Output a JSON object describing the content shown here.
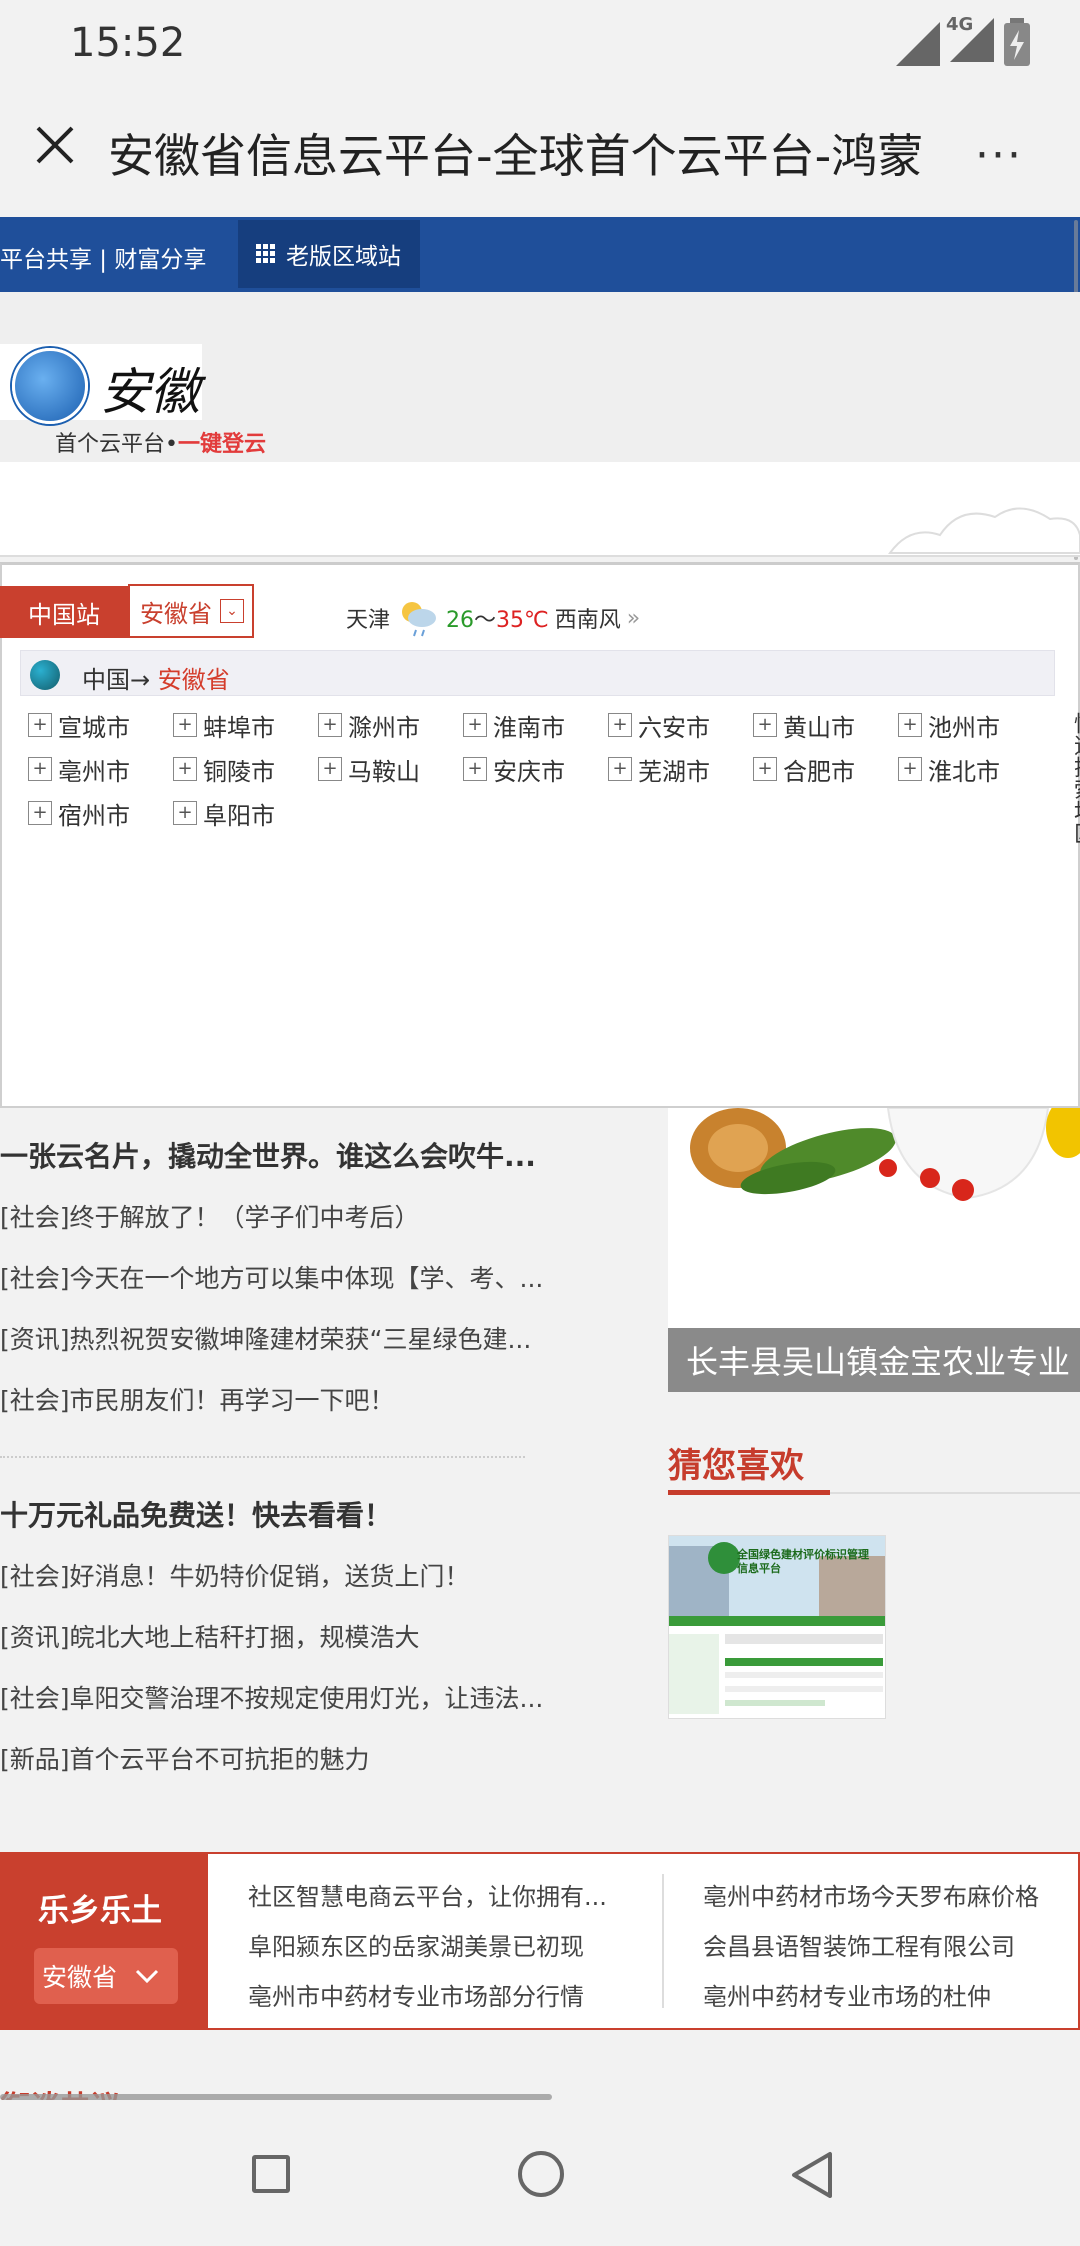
{
  "status": {
    "time": "15:52",
    "network": "4G"
  },
  "browser": {
    "title": "安徽省信息云平台-全球首个云平台-鸿蒙",
    "more": "···"
  },
  "topnav": {
    "links": "平台共享 | 财富分享",
    "old_site": "老版区域站"
  },
  "logo": {
    "tagline_prefix": "首个云平台•",
    "tagline_highlight": "一键登云"
  },
  "region": {
    "station_tab": "中国站",
    "province": "安徽省",
    "weather": {
      "city": "天津",
      "low": "26",
      "sep": "～",
      "high": "35℃",
      "wind": "西南风"
    },
    "crumb_prefix": "中国→",
    "crumb_current": "安徽省",
    "cities": [
      "宣城市",
      "蚌埠市",
      "滁州市",
      "淮南市",
      "六安市",
      "黄山市",
      "池州市",
      "亳州市",
      "铜陵市",
      "马鞍山",
      "安庆市",
      "芜湖市",
      "合肥市",
      "淮北市",
      "宿州市",
      "阜阳市"
    ],
    "side_text": "快速搜索地区"
  },
  "news": {
    "group1_title": "一张云名片，撬动全世界。谁这么会吹牛...",
    "group1_items": [
      "[社会]终于解放了！（学子们中考后）",
      "[社会]今天在一个地方可以集中体现【学、考、...",
      "[资讯]热烈祝贺安徽坤隆建材荣获“三星绿色建...",
      "[社会]市民朋友们！再学习一下吧！"
    ],
    "group2_title": "十万元礼品免费送！快去看看！",
    "group2_items": [
      "[社会]好消息！牛奶特价促销，送货上门！",
      "[资讯]皖北大地上秸秆打捆，规模浩大",
      "[社会]阜阳交警治理不按规定使用灯光，让违法...",
      "[新品]首个云平台不可抗拒的魅力"
    ]
  },
  "feature": {
    "caption": "长丰县吴山镇金宝农业专业"
  },
  "guess": {
    "title": "猜您喜欢",
    "thumb_heading": "全国绿色建材评价标识管理信息平台"
  },
  "strip": {
    "title": "乐乡乐土",
    "select": "安徽省",
    "col1": [
      "社区智慧电商云平台，让你拥有...",
      "阜阳颍东区的岳家湖美景已初现",
      "亳州市中药材专业市场部分行情"
    ],
    "col2": [
      "亳州中药材市场今天罗布麻价格",
      "会昌县语智装饰工程有限公司",
      "亳州中药材专业市场的杜仲"
    ]
  },
  "bottom_peek": "衔谈共议"
}
